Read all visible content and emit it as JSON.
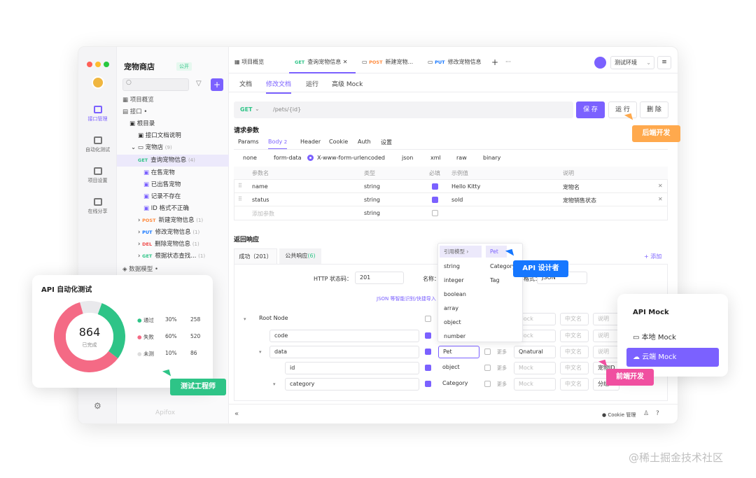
{
  "colors": {
    "accent": "#7b61ff",
    "green": "#2ec487",
    "red": "#f46a85",
    "orange": "#ffa94d",
    "blue": "#1677ff"
  },
  "sidebar": {
    "items": [
      {
        "label": "接口管理",
        "icon": "api-icon"
      },
      {
        "label": "自动化测试",
        "icon": "flow-icon"
      },
      {
        "label": "项目设置",
        "icon": "settings-icon"
      },
      {
        "label": "在线分享",
        "icon": "share-icon"
      }
    ]
  },
  "project": {
    "name": "宠物商店",
    "badge": "公开",
    "add": "+"
  },
  "search": {
    "placeholder": ""
  },
  "tree": {
    "overview": "项目概览",
    "api": "接口 •",
    "root": "根目录",
    "doc": "接口文档说明",
    "shop": "宠物店",
    "shop_count": "(9)",
    "items": [
      {
        "method": "GET",
        "label": "查询宠物信息",
        "count": "(4)"
      },
      {
        "label": "在售宠物"
      },
      {
        "label": "已出售宠物"
      },
      {
        "label": "记录不存在"
      },
      {
        "label": "ID 格式不正确"
      },
      {
        "method": "POST",
        "label": "新建宠物信息",
        "count": "(1)"
      },
      {
        "method": "PUT",
        "label": "修改宠物信息",
        "count": "(1)"
      },
      {
        "method": "DEL",
        "label": "删除宠物信息",
        "count": "(1)"
      },
      {
        "method": "GET",
        "label": "根据状态查找...",
        "count": "(1)"
      }
    ],
    "models": "数据模型 •",
    "footer": "Apifox"
  },
  "tabs": [
    {
      "label": "项目概览"
    },
    {
      "method": "GET",
      "label": "查询宠物信息"
    },
    {
      "method": "POST",
      "label": "新建宠物..."
    },
    {
      "method": "PUT",
      "label": "修改宠物信息"
    }
  ],
  "env": {
    "label": "测试环境"
  },
  "subtabs": [
    "文档",
    "修改文档",
    "运行",
    "高级 Mock"
  ],
  "request": {
    "method": "GET",
    "path": "/pets/{id}",
    "save": "保 存",
    "run": "运 行",
    "delete": "删 除"
  },
  "params": {
    "title": "请求参数",
    "tabs": [
      "Params",
      "Body",
      "Header",
      "Cookie",
      "Auth",
      "设置"
    ],
    "body_count": "2",
    "body_types": [
      "none",
      "form-data",
      "X-www-form-urlencoded",
      "json",
      "xml",
      "raw",
      "binary"
    ],
    "headers": [
      "参数名",
      "类型",
      "必填",
      "示例值",
      "说明"
    ],
    "rows": [
      {
        "name": "name",
        "type": "string",
        "example": "Hello Kitty",
        "desc": "宠物名"
      },
      {
        "name": "status",
        "type": "string",
        "example": "sold",
        "desc": "宠物销售状态"
      }
    ],
    "add_row": "添加参数",
    "add_type": "string"
  },
  "response": {
    "title": "返回响应",
    "tabs": [
      "成功（201）",
      "公共响应"
    ],
    "public_count": "(6)",
    "add": "+ 添加",
    "status_label": "HTTP 状态码：",
    "status": "201",
    "name_label": "名称：",
    "format_label": "格式：",
    "format": "JSON",
    "json_hint": "JSON 等智能识别/快捷导入",
    "tree": [
      {
        "name": "Root Node"
      },
      {
        "name": "code"
      },
      {
        "name": "data",
        "type": "Pet",
        "more": "更多",
        "mock": "Qnatural",
        "cn": "中文名",
        "desc": "说明"
      },
      {
        "name": "id",
        "type": "object",
        "more": "更多",
        "mock": "Mock",
        "cn": "中文名",
        "desc": "宠物ID"
      },
      {
        "name": "category",
        "type": "Category",
        "more": "更多",
        "mock": "Mock",
        "cn": "中文名",
        "desc": "分组"
      }
    ],
    "mock_ph": "Mock",
    "cn_ph": "中文名",
    "desc_ph": "说明"
  },
  "dropdown": {
    "ref": "引用模型",
    "types": [
      "string",
      "integer",
      "boolean",
      "array",
      "object",
      "number"
    ],
    "models": [
      "Pet",
      "Category",
      "Tag"
    ]
  },
  "footer": {
    "collapse": "«",
    "cookie": "Cookie 管理"
  },
  "auto_test": {
    "title": "API 自动化测试",
    "total": "864",
    "total_label": "已完成",
    "legend": [
      {
        "label": "通过",
        "pct": "30%",
        "count": "258"
      },
      {
        "label": "失败",
        "pct": "60%",
        "count": "520"
      },
      {
        "label": "未测",
        "pct": "10%",
        "count": "86"
      }
    ],
    "chart_data": {
      "type": "pie",
      "categories": [
        "通过",
        "失败",
        "未测"
      ],
      "values": [
        258,
        520,
        86
      ]
    }
  },
  "api_mock": {
    "title": "API Mock",
    "local": "本地 Mock",
    "cloud": "云端 Mock"
  },
  "badges": {
    "backend": "后端开发",
    "designer": "API 设计者",
    "tester": "测试工程师",
    "frontend": "前端开发"
  },
  "watermark": "@稀土掘金技术社区"
}
